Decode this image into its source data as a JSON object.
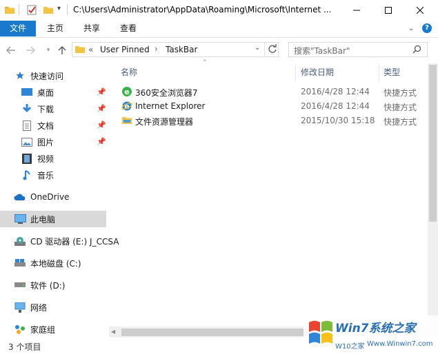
{
  "window": {
    "title": "C:\\Users\\Administrator\\AppData\\Roaming\\Microsoft\\Internet ..."
  },
  "ribbon": {
    "tabs": [
      {
        "label": "文件"
      },
      {
        "label": "主页"
      },
      {
        "label": "共享"
      },
      {
        "label": "查看"
      }
    ]
  },
  "address": {
    "prefix": "«",
    "crumbs": [
      "User Pinned",
      "TaskBar"
    ],
    "separator": "›"
  },
  "search": {
    "placeholder": "搜索\"TaskBar\""
  },
  "columns": {
    "name": "名称",
    "date": "修改日期",
    "type": "类型"
  },
  "files": [
    {
      "name": "360安全浏览器7",
      "date": "2016/4/28 12:44",
      "type": "快捷方式",
      "icon": "360-browser-icon"
    },
    {
      "name": "Internet Explorer",
      "date": "2016/4/28 12:44",
      "type": "快捷方式",
      "icon": "internet-explorer-icon"
    },
    {
      "name": "文件资源管理器",
      "date": "2015/10/30 15:18",
      "type": "快捷方式",
      "icon": "file-explorer-icon"
    }
  ],
  "nav": {
    "quick_access": "快速访问",
    "pinned": [
      {
        "label": "桌面"
      },
      {
        "label": "下载"
      },
      {
        "label": "文档"
      },
      {
        "label": "图片"
      },
      {
        "label": "视频"
      },
      {
        "label": "音乐"
      }
    ],
    "onedrive": "OneDrive",
    "this_pc": "此电脑",
    "cd_drive": "CD 驱动器 (E:) J_CCSA",
    "local_disk": "本地磁盘 (C:)",
    "software_disk": "软件 (D:)",
    "network": "网络",
    "homegroup": "家庭组"
  },
  "status": {
    "item_count": "3 个项目"
  },
  "watermark": {
    "brand": "Win7系统之家",
    "url": "Www.Winwin7.com",
    "sub": "W10之家"
  },
  "colors": {
    "file_tab": "#1979ca",
    "selected_nav": "#d9d9d9",
    "header_text": "#4c607a"
  }
}
